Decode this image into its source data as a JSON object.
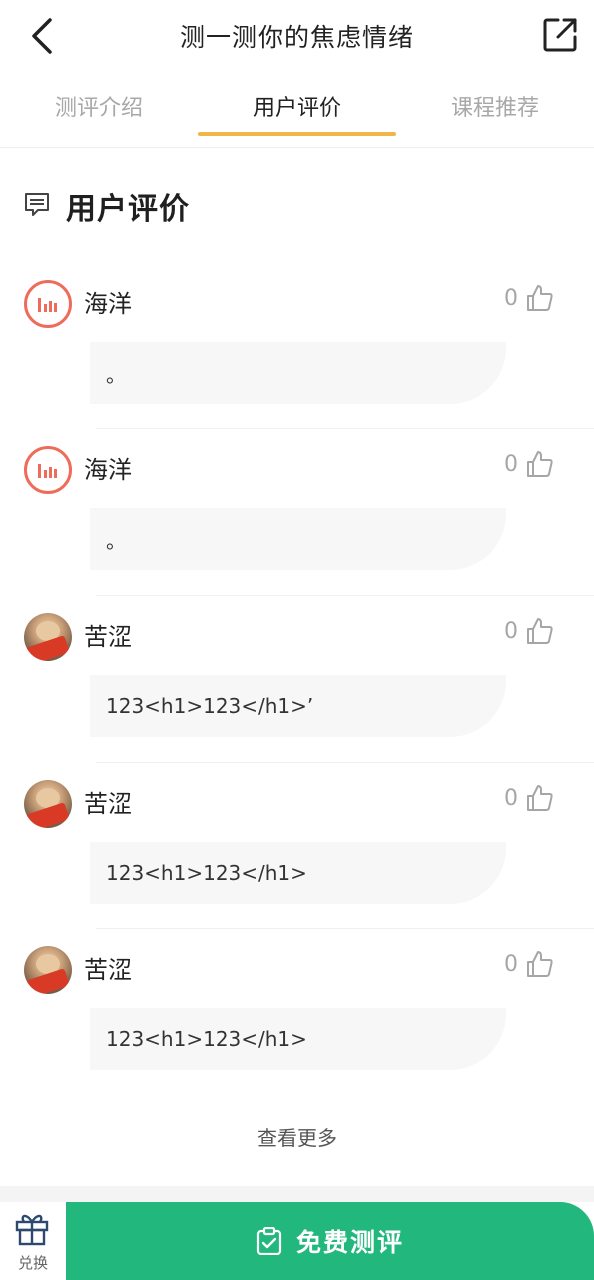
{
  "header": {
    "title": "测一测你的焦虑情绪",
    "back_icon": "chevron-left-icon",
    "share_icon": "external-link-icon"
  },
  "tabs": [
    {
      "label": "测评介绍",
      "active": false
    },
    {
      "label": "用户评价",
      "active": true
    },
    {
      "label": "课程推荐",
      "active": false
    }
  ],
  "colors": {
    "accent_tab": "#f1b64a",
    "cta_green": "#22b77c",
    "logo_red": "#ef6b5a"
  },
  "section": {
    "title": "用户评价",
    "icon": "message-icon"
  },
  "comments": [
    {
      "username": "海洋",
      "likes": "0",
      "text": "。",
      "avatar": "brand-logo"
    },
    {
      "username": "海洋",
      "likes": "0",
      "text": "。",
      "avatar": "brand-logo"
    },
    {
      "username": "苦涩",
      "likes": "0",
      "text": "123<h1>123</h1>’",
      "avatar": "photo"
    },
    {
      "username": "苦涩",
      "likes": "0",
      "text": "123<h1>123</h1>",
      "avatar": "photo"
    },
    {
      "username": "苦涩",
      "likes": "0",
      "text": "123<h1>123</h1>",
      "avatar": "photo"
    }
  ],
  "view_more": "查看更多",
  "bottom": {
    "redeem_label": "兑换",
    "redeem_icon": "gift-icon",
    "cta_label": "免费测评",
    "cta_icon": "clipboard-check-icon"
  }
}
